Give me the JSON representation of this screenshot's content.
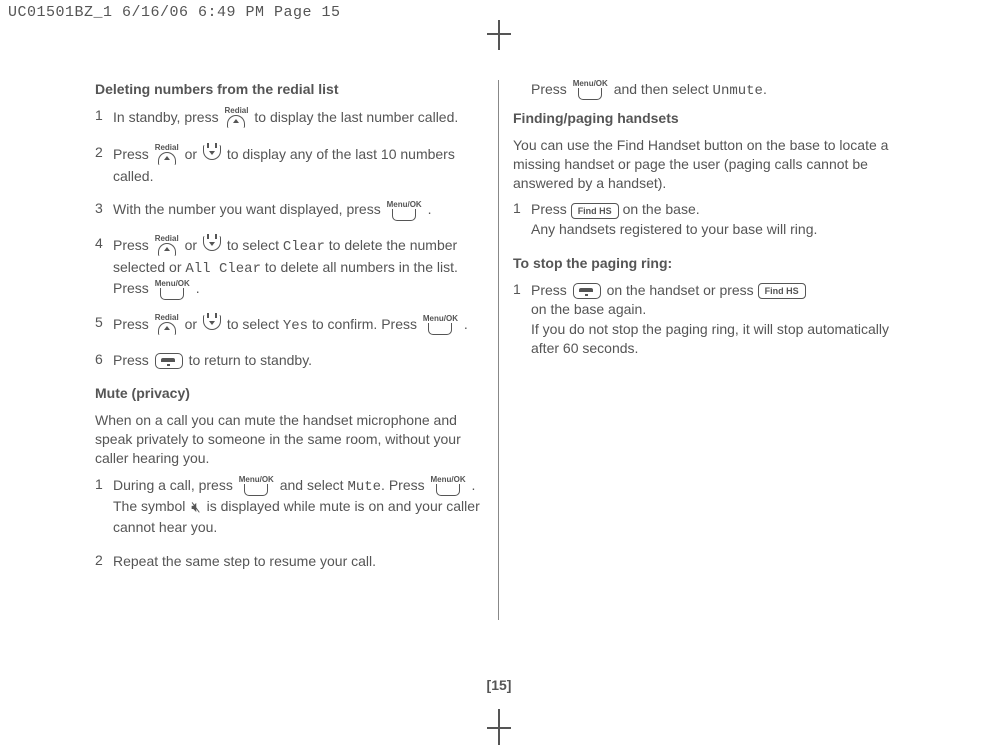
{
  "header": "UC01501BZ_1  6/16/06  6:49 PM  Page 15",
  "left": {
    "h1": "Deleting numbers from the redial list",
    "s1a": "In standby, press ",
    "s1b": " to display the last number called.",
    "s2a": "Press ",
    "s2or": " or ",
    "s2b": " to display any of the last 10 numbers called.",
    "s3a": "With the number you want displayed, press ",
    "s3b": " .",
    "s4a": "Press ",
    "s4or": " or ",
    "s4b": " to select ",
    "s4clear": "Clear",
    "s4c": " to delete the number selected or ",
    "s4all": "All Clear",
    "s4d": " to delete all numbers in the list. Press ",
    "s4e": " .",
    "s5a": "Press ",
    "s5or": " or ",
    "s5b": " to select ",
    "s5yes": "Yes",
    "s5c": " to confirm. Press ",
    "s5d": " .",
    "s6a": "Press ",
    "s6b": " to return to standby.",
    "h2": "Mute (privacy)",
    "mute_intro": "When on a call you can mute the handset microphone and speak privately to someone in the same room, without your caller hearing you.",
    "m1a": "During a call, press ",
    "m1b": " and select ",
    "m1mute": "Mute",
    "m1c": ". Press ",
    "m1d": " .",
    "m1e": "The symbol ",
    "m1f": " is displayed while mute is on and your caller cannot hear you.",
    "m2": "Repeat the same step to resume your call."
  },
  "right": {
    "top_a": "Press ",
    "top_b": " and then select ",
    "top_unmute": "Unmute",
    "top_c": ".",
    "h1": "Finding/paging handsets",
    "intro": "You can use the Find Handset button on the base to locate a missing handset or page the user (paging calls cannot be answered by a handset).",
    "s1a": "Press ",
    "findhs": "Find HS",
    "s1b": " on the base.",
    "s1c": "Any handsets registered to your base will ring.",
    "h2": "To stop the paging ring:",
    "p1a": "Press ",
    "p1b": " on the handset or press ",
    "p1c": "on the base again.",
    "p1d": "If you do not stop the paging ring, it will stop automatically after 60 seconds."
  },
  "pagenum": "[15]",
  "icon_labels": {
    "menuok": "Menu/OK",
    "redial": "Redial"
  }
}
